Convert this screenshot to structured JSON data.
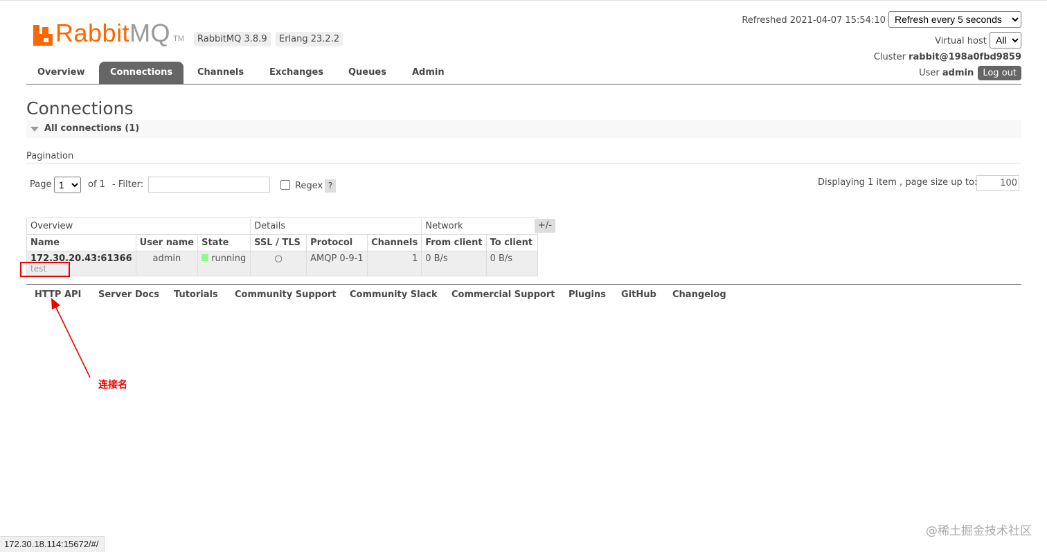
{
  "brand": {
    "rabbit": "Rabbit",
    "mq": "MQ",
    "tm": "TM"
  },
  "versions": {
    "rabbitmq": "RabbitMQ 3.8.9",
    "erlang": "Erlang 23.2.2"
  },
  "header": {
    "refreshed_label": "Refreshed 2021-04-07 15:54:10",
    "refresh_select": "Refresh every 5 seconds",
    "vhost_label": "Virtual host",
    "vhost_value": "All",
    "cluster_label": "Cluster",
    "cluster_value": "rabbit@198a0fbd9859",
    "user_label": "User",
    "user_value": "admin",
    "logout": "Log out"
  },
  "tabs": [
    {
      "label": "Overview",
      "active": false
    },
    {
      "label": "Connections",
      "active": true
    },
    {
      "label": "Channels",
      "active": false
    },
    {
      "label": "Exchanges",
      "active": false
    },
    {
      "label": "Queues",
      "active": false
    },
    {
      "label": "Admin",
      "active": false
    }
  ],
  "page_title": "Connections",
  "section_title": "All connections (1)",
  "pagination": {
    "label": "Pagination",
    "page_label": "Page",
    "page_value": "1",
    "of_label": "of 1",
    "filter_label": "- Filter:",
    "filter_value": "",
    "regex_label": "Regex",
    "help": "?",
    "displaying": "Displaying 1 item , page size up to:",
    "page_size": "100"
  },
  "table": {
    "groups": [
      "Overview",
      "Details",
      "Network"
    ],
    "columns": [
      "Name",
      "User name",
      "State",
      "SSL / TLS",
      "Protocol",
      "Channels",
      "From client",
      "To client"
    ],
    "rows": [
      {
        "name": "172.30.20.43:61366",
        "sub": "test",
        "user": "admin",
        "state": "running",
        "ssl": "○",
        "protocol": "AMQP 0-9-1",
        "channels": "1",
        "from_client": "0 B/s",
        "to_client": "0 B/s"
      }
    ],
    "toggle": "+/-"
  },
  "footer_links": [
    "HTTP API",
    "Server Docs",
    "Tutorials",
    "Community Support",
    "Community Slack",
    "Commercial Support",
    "Plugins",
    "GitHub",
    "Changelog"
  ],
  "annotation": "连接名",
  "status_url": "172.30.18.114:15672/#/",
  "watermark": "@稀土掘金技术社区",
  "colors": {
    "accent": "#ff6600",
    "tab_active": "#666666",
    "state_running": "#88ff88",
    "annotation": "#ee0000"
  }
}
